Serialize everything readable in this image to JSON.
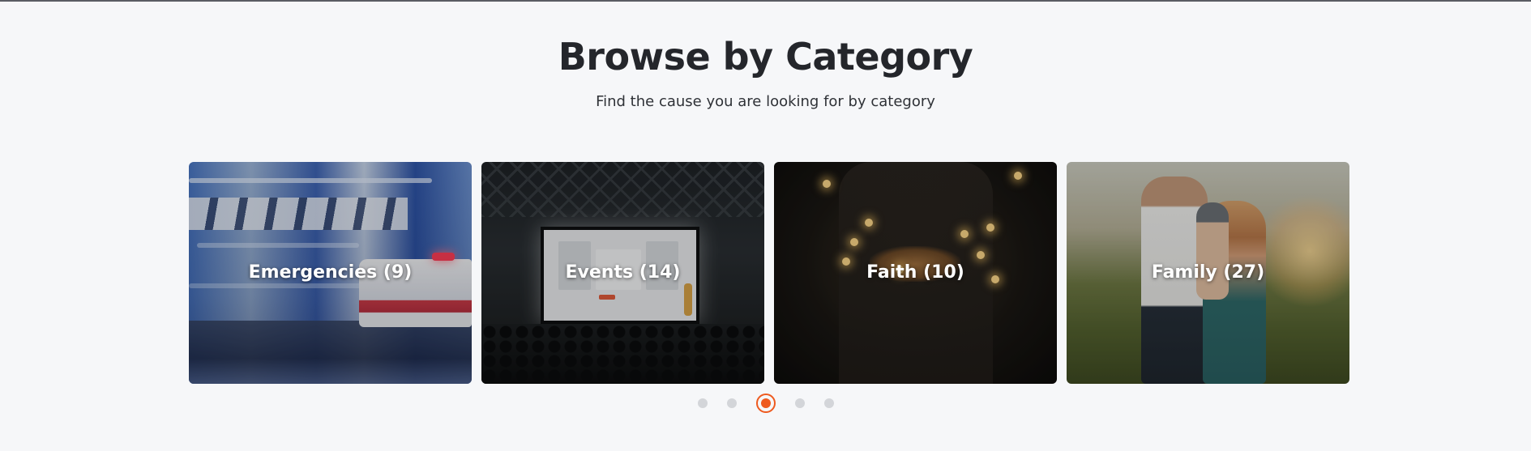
{
  "section": {
    "title": "Browse by Category",
    "subtitle": "Find the cause you are looking for by category"
  },
  "categories": [
    {
      "label": "Emergencies (9)",
      "image": "ambulance-motion-blur"
    },
    {
      "label": "Events (14)",
      "image": "conference-presentation-screen"
    },
    {
      "label": "Faith (10)",
      "image": "hands-holding-lights"
    },
    {
      "label": "Family (27)",
      "image": "family-in-field-at-sunset"
    }
  ],
  "pagination": {
    "total": 5,
    "active_index": 2
  },
  "colors": {
    "accent": "#ee5a1f",
    "background": "#f6f7f9",
    "title": "#24262b",
    "dot_inactive": "#d3d5d9"
  }
}
